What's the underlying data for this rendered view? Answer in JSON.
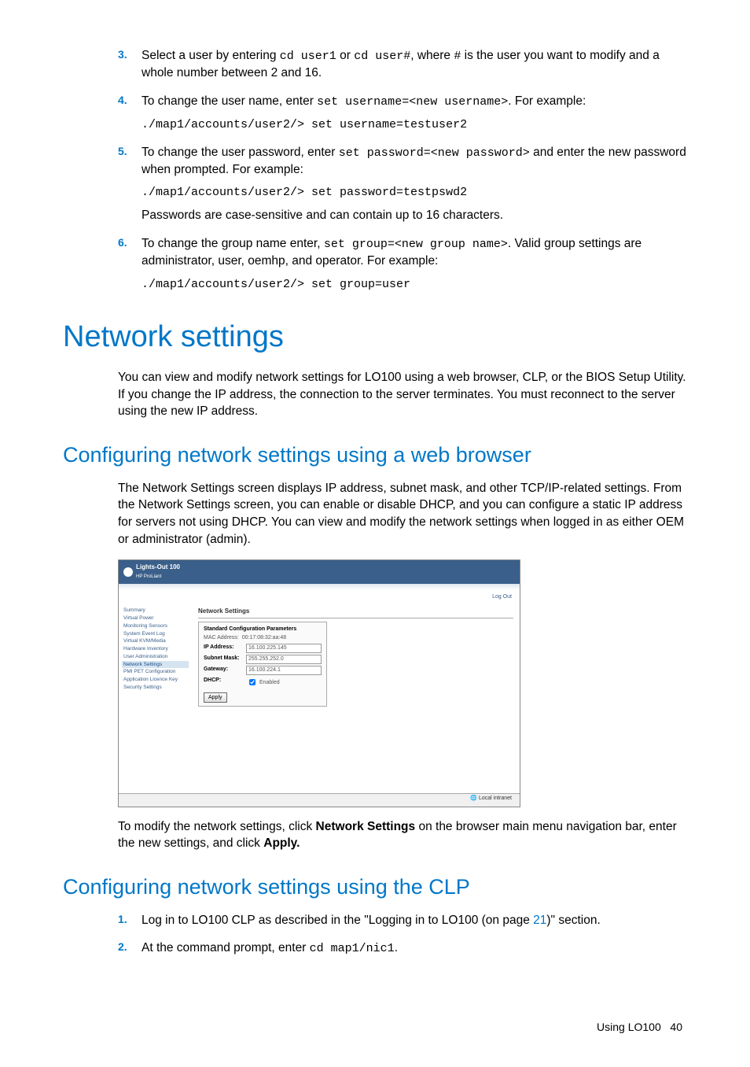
{
  "steps_top": [
    {
      "num": "3.",
      "html_segments": [
        {
          "t": "Select a user by entering "
        },
        {
          "t": "cd user1",
          "code": true
        },
        {
          "t": " or "
        },
        {
          "t": "cd user#",
          "code": true
        },
        {
          "t": ", where "
        },
        {
          "t": "#",
          "code": true
        },
        {
          "t": " is the user you want to modify and a whole number between 2 and 16."
        }
      ]
    },
    {
      "num": "4.",
      "html_segments": [
        {
          "t": "To change the user name, enter "
        },
        {
          "t": "set username=<new username>",
          "code": true
        },
        {
          "t": ". For example:"
        }
      ],
      "sub_code": "./map1/accounts/user2/> set username=testuser2"
    },
    {
      "num": "5.",
      "html_segments": [
        {
          "t": "To change the user password, enter "
        },
        {
          "t": "set password=<new password>",
          "code": true
        },
        {
          "t": " and enter the new password when prompted. For example:"
        }
      ],
      "sub_code": "./map1/accounts/user2/> set password=testpswd2",
      "sub_text": "Passwords are case-sensitive and can contain up to 16 characters."
    },
    {
      "num": "6.",
      "html_segments": [
        {
          "t": "To change the group name enter, "
        },
        {
          "t": "set group=<new group name>",
          "code": true
        },
        {
          "t": ". Valid group settings are administrator, user, oemhp, and operator. For example:"
        }
      ],
      "sub_code": "./map1/accounts/user2/> set group=user"
    }
  ],
  "h1": "Network settings",
  "intro": "You can view and modify network settings for LO100 using a web browser, CLP, or the BIOS Setup Utility. If you change the IP address, the connection to the server terminates. You must reconnect to the server using the new IP address.",
  "h2a": "Configuring network settings using a web browser",
  "para_a": "The Network Settings screen displays IP address, subnet mask, and other TCP/IP-related settings. From the Network Settings screen, you can enable or disable DHCP, and you can configure a static IP address for servers not using DHCP. You can view and modify the network settings when logged in as either OEM or administrator (admin).",
  "screenshot": {
    "product": "Lights-Out 100",
    "subproduct": "HP ProLiant",
    "logout": "Log Out",
    "nav": [
      "Summary",
      "Virtual Power",
      "Monitoring Sensors",
      "System Event Log",
      "Virtual KVM/Media",
      "Hardware Inventory",
      "User Administration",
      "Network Settings",
      "PMI PET Configuration",
      "Application Licence Key",
      "Security Settings"
    ],
    "nav_selected_index": 7,
    "panel_title": "Network Settings",
    "box_header": "Standard Configuration Parameters",
    "mac_label": "MAC Address:",
    "mac_value": "00:17:08:32:aa:48",
    "rows": [
      {
        "label": "IP Address:",
        "value": "16.100.225.145"
      },
      {
        "label": "Subnet Mask:",
        "value": "255.255.252.0"
      },
      {
        "label": "Gateway:",
        "value": "16.100.224.1"
      }
    ],
    "dhcp_label": "DHCP:",
    "dhcp_value": "Enabled",
    "apply": "Apply",
    "status": "Local intranet"
  },
  "para_after_shot_pre": "To modify the network settings, click ",
  "para_after_shot_bold1": "Network Settings",
  "para_after_shot_mid": " on the browser main menu navigation bar, enter the new settings, and click ",
  "para_after_shot_bold2": "Apply.",
  "h2b": "Configuring network settings using the CLP",
  "steps_clp": [
    {
      "num": "1.",
      "pre": "Log in to LO100 CLP as described in the \"Logging in to LO100 (on page ",
      "link": "21",
      "post": ")\" section."
    },
    {
      "num": "2.",
      "pre": "At the command prompt, enter ",
      "code": "cd map1/nic1",
      "post": "."
    }
  ],
  "footer_text": "Using LO100",
  "footer_page": "40"
}
